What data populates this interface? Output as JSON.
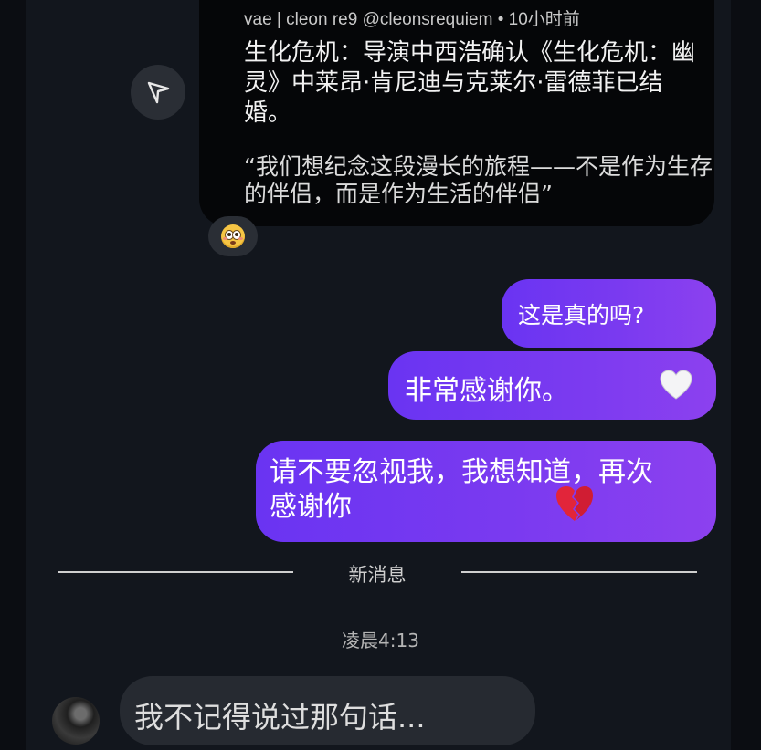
{
  "shared_post": {
    "meta": "vae | cleon re9 @cleonsrequiem • 10小时前",
    "title": "生化危机：导演中西浩确认《生化危机：幽灵》中莱昂·肯尼迪与克莱尔·雷德菲已结婚。",
    "quote": "“我们想纪念这段漫长的旅程——不是作为生存的伴侣，而是作为生活的伴侣”",
    "reaction_icon": "flushed-face-emoji"
  },
  "share_button": {
    "icon": "send-arrow-icon"
  },
  "sent_messages": [
    {
      "text": "这是真的吗?"
    },
    {
      "text": "非常感谢你。",
      "icon": "white-heart-icon"
    },
    {
      "text": "请不要忽视我，我想知道，再次感谢你",
      "icon": "broken-heart-icon"
    }
  ],
  "divider_label": "新消息",
  "timestamp": "凌晨4:13",
  "received_message": {
    "text": "我不记得说过那句话..."
  },
  "colors": {
    "background": "#0b0d12",
    "panel": "#12161d",
    "bubble_sent_start": "#6a34f2",
    "bubble_sent_end": "#8c41ef",
    "bubble_received": "#262a31"
  }
}
